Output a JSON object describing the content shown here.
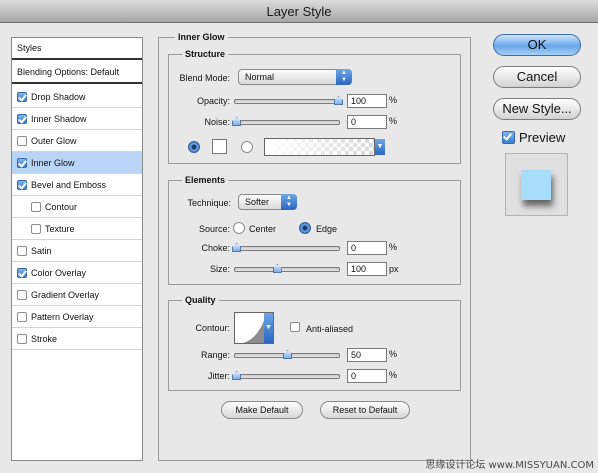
{
  "title": "Layer Style",
  "styles_panel": {
    "header": "Styles",
    "blending": "Blending Options: Default",
    "items": [
      {
        "label": "Drop Shadow",
        "checked": true,
        "sub": false,
        "selected": false
      },
      {
        "label": "Inner Shadow",
        "checked": true,
        "sub": false,
        "selected": false
      },
      {
        "label": "Outer Glow",
        "checked": false,
        "sub": false,
        "selected": false
      },
      {
        "label": "Inner Glow",
        "checked": true,
        "sub": false,
        "selected": true
      },
      {
        "label": "Bevel and Emboss",
        "checked": true,
        "sub": false,
        "selected": false
      },
      {
        "label": "Contour",
        "checked": false,
        "sub": true,
        "selected": false
      },
      {
        "label": "Texture",
        "checked": false,
        "sub": true,
        "selected": false
      },
      {
        "label": "Satin",
        "checked": false,
        "sub": false,
        "selected": false
      },
      {
        "label": "Color Overlay",
        "checked": true,
        "sub": false,
        "selected": false
      },
      {
        "label": "Gradient Overlay",
        "checked": false,
        "sub": false,
        "selected": false
      },
      {
        "label": "Pattern Overlay",
        "checked": false,
        "sub": false,
        "selected": false
      },
      {
        "label": "Stroke",
        "checked": false,
        "sub": false,
        "selected": false
      }
    ]
  },
  "inner_glow": {
    "title": "Inner Glow",
    "structure": {
      "title": "Structure",
      "blend_mode_label": "Blend Mode:",
      "blend_mode_value": "Normal",
      "opacity_label": "Opacity:",
      "opacity_value": "100",
      "opacity_unit": "%",
      "opacity_level": 1.0,
      "noise_label": "Noise:",
      "noise_value": "0",
      "noise_unit": "%",
      "noise_level": 0.0,
      "color_swatch": "#ffffff",
      "color_mode": "solid"
    },
    "elements": {
      "title": "Elements",
      "technique_label": "Technique:",
      "technique_value": "Softer",
      "source_label": "Source:",
      "source_center": "Center",
      "source_edge": "Edge",
      "source_selected": "edge",
      "choke_label": "Choke:",
      "choke_value": "0",
      "choke_unit": "%",
      "choke_level": 0.0,
      "size_label": "Size:",
      "size_value": "100",
      "size_unit": "px",
      "size_level": 0.4
    },
    "quality": {
      "title": "Quality",
      "contour_label": "Contour:",
      "antialiased_label": "Anti-aliased",
      "antialiased_checked": false,
      "range_label": "Range:",
      "range_value": "50",
      "range_unit": "%",
      "range_level": 0.5,
      "jitter_label": "Jitter:",
      "jitter_value": "0",
      "jitter_unit": "%",
      "jitter_level": 0.0
    },
    "make_default": "Make Default",
    "reset_default": "Reset to Default"
  },
  "buttons": {
    "ok": "OK",
    "cancel": "Cancel",
    "new_style": "New Style...",
    "preview_label": "Preview",
    "preview_checked": true
  },
  "watermark": "思缘设计论坛 www.MISSYUAN.COM",
  "colors": {
    "accent": "#3a7fd0",
    "selected_row": "#b8d4f6",
    "preview_swatch": "#a8dcfb"
  }
}
